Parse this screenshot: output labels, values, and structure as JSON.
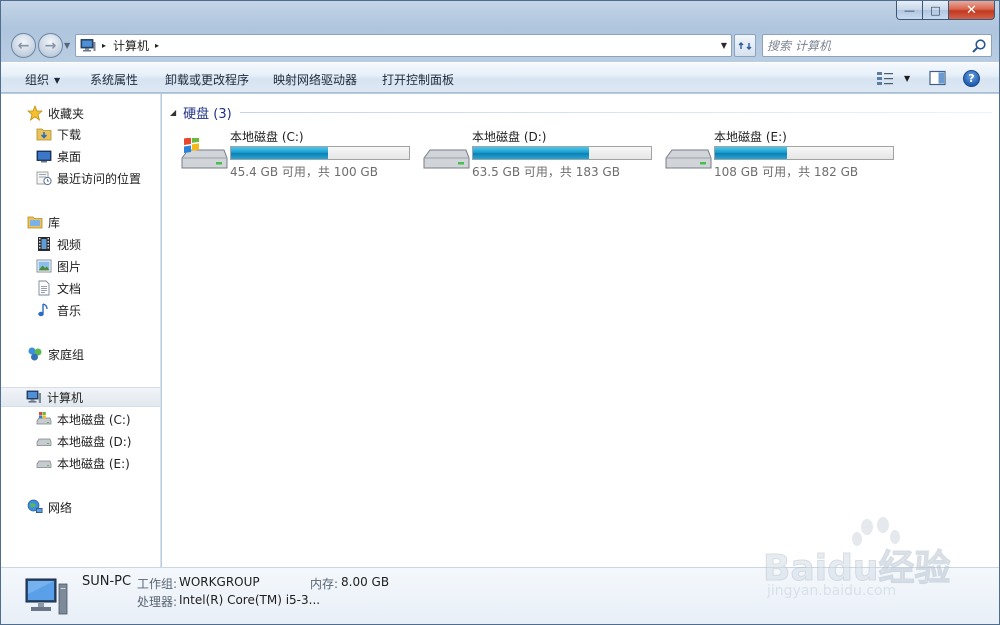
{
  "window": {
    "minimize_glyph": "—",
    "maximize_glyph": "□",
    "close_glyph": "✕"
  },
  "address": {
    "segments": [
      "计算机"
    ],
    "separator_glyph": "▸"
  },
  "search": {
    "placeholder": "搜索 计算机"
  },
  "toolbar": {
    "organize": "组织",
    "system_properties": "系统属性",
    "uninstall": "卸载或更改程序",
    "map_drive": "映射网络驱动器",
    "control_panel": "打开控制面板"
  },
  "sidebar": {
    "favorites": {
      "label": "收藏夹",
      "items": [
        {
          "label": "下载",
          "icon": "downloads-folder-icon"
        },
        {
          "label": "桌面",
          "icon": "desktop-icon"
        },
        {
          "label": "最近访问的位置",
          "icon": "recent-places-icon"
        }
      ]
    },
    "libraries": {
      "label": "库",
      "items": [
        {
          "label": "视频",
          "icon": "videos-icon"
        },
        {
          "label": "图片",
          "icon": "pictures-icon"
        },
        {
          "label": "文档",
          "icon": "documents-icon"
        },
        {
          "label": "音乐",
          "icon": "music-icon"
        }
      ]
    },
    "homegroup": {
      "label": "家庭组"
    },
    "computer": {
      "label": "计算机",
      "items": [
        {
          "label": "本地磁盘 (C:)",
          "icon": "system-drive-icon"
        },
        {
          "label": "本地磁盘 (D:)",
          "icon": "drive-icon"
        },
        {
          "label": "本地磁盘 (E:)",
          "icon": "drive-icon"
        }
      ]
    },
    "network": {
      "label": "网络"
    }
  },
  "main": {
    "group_title": "硬盘 (3)",
    "drives": [
      {
        "name": "本地磁盘 (C:)",
        "free_text": "45.4 GB 可用，共 100 GB",
        "used_fraction": 0.546,
        "system": true
      },
      {
        "name": "本地磁盘 (D:)",
        "free_text": "63.5 GB 可用，共 183 GB",
        "used_fraction": 0.653,
        "system": false
      },
      {
        "name": "本地磁盘 (E:)",
        "free_text": "108 GB 可用，共 182 GB",
        "used_fraction": 0.407,
        "system": false
      }
    ]
  },
  "details": {
    "pc_name": "SUN-PC",
    "workgroup_label": "工作组:",
    "workgroup_value": "WORKGROUP",
    "memory_label": "内存:",
    "memory_value": "8.00 GB",
    "cpu_label": "处理器:",
    "cpu_value": "Intel(R) Core(TM) i5-3..."
  },
  "watermark": {
    "brand": "Baidu经验",
    "url": "jingyan.baidu.com"
  },
  "colors": {
    "group_title": "#1e3287",
    "bar_fill": "#1a9ed0",
    "selection": "#e2e8ef"
  }
}
